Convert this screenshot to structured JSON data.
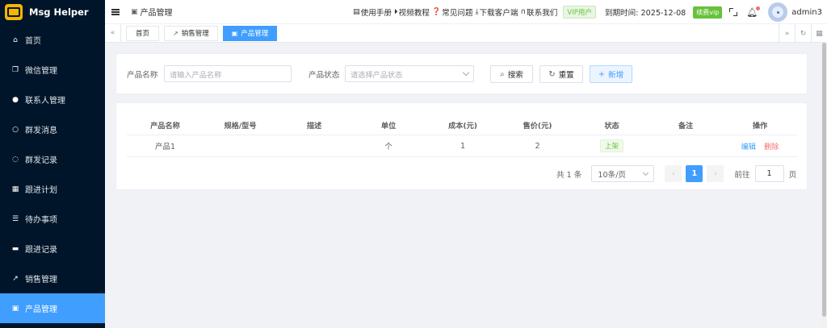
{
  "app": {
    "name": "Msg Helper"
  },
  "sidebar": {
    "items": [
      {
        "label": "首页",
        "icon": "home-icon"
      },
      {
        "label": "微信管理",
        "icon": "copy-icon"
      },
      {
        "label": "联系人管理",
        "icon": "user-icon"
      },
      {
        "label": "群发消息",
        "icon": "chat-icon"
      },
      {
        "label": "群发记录",
        "icon": "chat-dots-icon"
      },
      {
        "label": "跟进计划",
        "icon": "calendar-icon"
      },
      {
        "label": "待办事项",
        "icon": "list-icon"
      },
      {
        "label": "跟进记录",
        "icon": "briefcase-icon"
      },
      {
        "label": "销售管理",
        "icon": "trend-chart-icon"
      },
      {
        "label": "产品管理",
        "icon": "box-icon",
        "active": true
      }
    ]
  },
  "topbar": {
    "breadcrumb": "产品管理",
    "links": [
      "使用手册",
      "视频教程",
      "常见问题",
      "下载客户端",
      "联系我们"
    ],
    "vip_badge": "VIP用户",
    "expire_text": "到期时间: 2025-12-08",
    "renew_label": "续费vip",
    "username": "admin3"
  },
  "tabs": [
    {
      "label": "首页",
      "active": false
    },
    {
      "label": "销售管理",
      "active": false
    },
    {
      "label": "产品管理",
      "active": true
    }
  ],
  "search": {
    "name_label": "产品名称",
    "name_placeholder": "请输入产品名称",
    "status_label": "产品状态",
    "status_placeholder": "请选择产品状态",
    "search_label": "搜索",
    "reset_label": "重置",
    "add_label": "新增"
  },
  "table": {
    "columns": [
      "产品名称",
      "规格/型号",
      "描述",
      "单位",
      "成本(元)",
      "售价(元)",
      "状态",
      "备注",
      "操作"
    ],
    "rows": [
      {
        "name": "产品1",
        "spec": "",
        "desc": "",
        "unit": "个",
        "cost": "1",
        "price": "2",
        "status": "上架",
        "remark": "",
        "edit": "编辑",
        "delete": "删除"
      }
    ]
  },
  "pagination": {
    "total_text": "共 1 条",
    "page_size": "10条/页",
    "current_page": "1",
    "goto_label": "前往",
    "goto_value": "1",
    "page_suffix": "页"
  },
  "colors": {
    "primary": "#409eff",
    "sidebar_bg": "#001529",
    "success": "#67c23a",
    "danger": "#f56c6c"
  }
}
